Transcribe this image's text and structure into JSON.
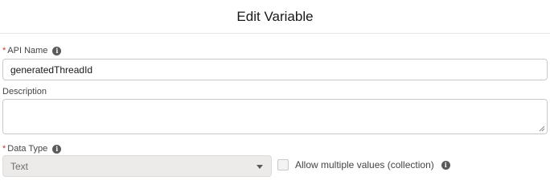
{
  "header": {
    "title": "Edit Variable"
  },
  "api_name": {
    "required_mark": "*",
    "label": "API Name",
    "info_icon": "info-icon",
    "value": "generatedThreadId"
  },
  "description": {
    "label": "Description",
    "value": ""
  },
  "data_type": {
    "required_mark": "*",
    "label": "Data Type",
    "info_icon": "info-icon",
    "selected": "Text",
    "disabled": true
  },
  "collection": {
    "label": "Allow multiple values (collection)",
    "checked": false,
    "info_icon": "info-icon"
  },
  "colors": {
    "required": "#c23934",
    "border": "#c9c9c9",
    "disabled_bg": "#ecebea"
  }
}
